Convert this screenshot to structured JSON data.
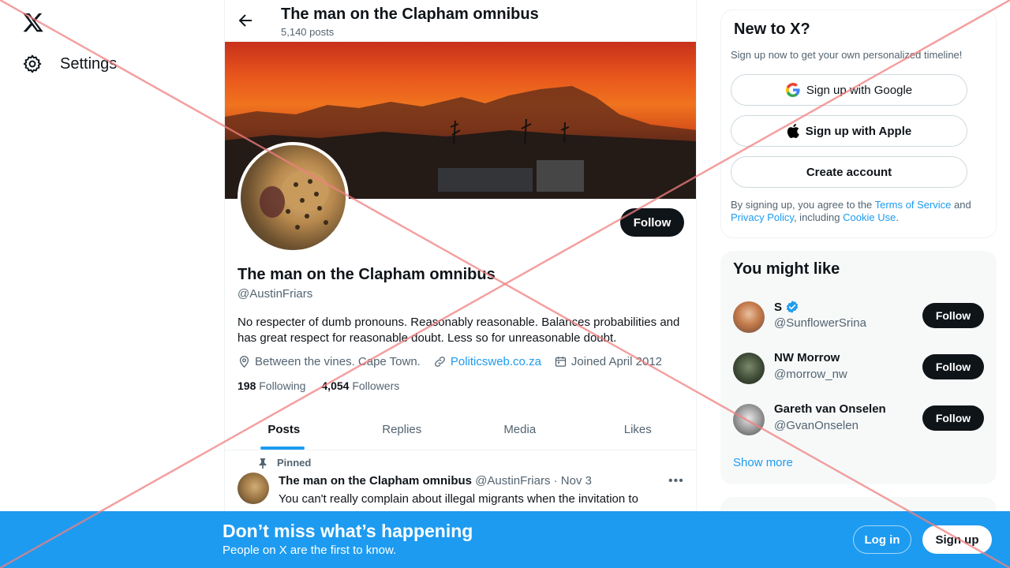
{
  "nav": {
    "settings_label": "Settings"
  },
  "header": {
    "title": "The man on the Clapham omnibus",
    "post_count": "5,140 posts"
  },
  "profile": {
    "name": "The man on the Clapham omnibus",
    "handle": "@AustinFriars",
    "follow_label": "Follow",
    "bio": "No respecter of dumb pronouns. Reasonably reasonable. Balances probabilities and has great respect for reasonable doubt. Less so for unreasonable doubt.",
    "location": "Between the vines. Cape Town.",
    "website": "Politicsweb.co.za",
    "joined": "Joined April 2012",
    "following_count": "198",
    "following_label": "Following",
    "followers_count": "4,054",
    "followers_label": "Followers"
  },
  "tabs": [
    "Posts",
    "Replies",
    "Media",
    "Likes"
  ],
  "post": {
    "pinned_label": "Pinned",
    "author": "The man on the Clapham omnibus",
    "meta": "@AustinFriars · Nov 3",
    "text": "You can't really complain about illegal migrants when the invitation to"
  },
  "new_to_x": {
    "title": "New to X?",
    "subtitle": "Sign up now to get your own personalized timeline!",
    "google_label": "Sign up with Google",
    "apple_label": "Sign up with Apple",
    "create_label": "Create account",
    "legal_prefix": "By signing up, you agree to the ",
    "terms_label": "Terms of Service",
    "legal_and": " and ",
    "privacy_label": "Privacy Policy",
    "legal_including": ", including ",
    "cookie_label": "Cookie Use",
    "legal_end": "."
  },
  "might_like": {
    "title": "You might like",
    "users": [
      {
        "name": "S",
        "handle": "@SunflowerSrina",
        "verified": true,
        "follow_label": "Follow"
      },
      {
        "name": "NW Morrow",
        "handle": "@morrow_nw",
        "verified": false,
        "follow_label": "Follow"
      },
      {
        "name": "Gareth van Onselen",
        "handle": "@GvanOnselen",
        "verified": false,
        "follow_label": "Follow"
      }
    ],
    "show_more": "Show more"
  },
  "bottom_bar": {
    "title": "Don’t miss what’s happening",
    "subtitle": "People on X are the first to know.",
    "login_label": "Log in",
    "signup_label": "Sign up"
  },
  "colors": {
    "accent": "#1d9bf0",
    "text": "#0f1419",
    "muted": "#536471",
    "watermark": "#f08080"
  }
}
